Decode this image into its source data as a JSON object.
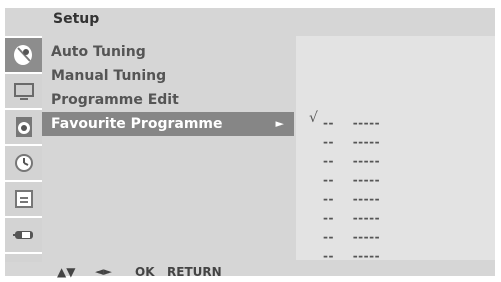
{
  "header": {
    "title": "Setup"
  },
  "sidebar": {
    "items": [
      {
        "icon": "satellite-dish-icon"
      },
      {
        "icon": "tv-picture-icon"
      },
      {
        "icon": "speaker-audio-icon"
      },
      {
        "icon": "clock-time-icon"
      },
      {
        "icon": "lock-option-icon"
      },
      {
        "icon": "input-source-icon"
      }
    ]
  },
  "menu": {
    "items": [
      {
        "label": "Auto Tuning"
      },
      {
        "label": "Manual Tuning"
      },
      {
        "label": "Programme Edit"
      },
      {
        "label": "Favourite Programme",
        "arrow": "►"
      }
    ]
  },
  "favourites": {
    "checkmark": "√",
    "rows": [
      {
        "number": "--",
        "name": "-----"
      },
      {
        "number": "--",
        "name": "-----"
      },
      {
        "number": "--",
        "name": "-----"
      },
      {
        "number": "--",
        "name": "-----"
      },
      {
        "number": "--",
        "name": "-----"
      },
      {
        "number": "--",
        "name": "-----"
      },
      {
        "number": "--",
        "name": "-----"
      },
      {
        "number": "--",
        "name": "-----"
      }
    ]
  },
  "footer": {
    "updown": "▲▼",
    "leftright": "◄►",
    "ok": "OK",
    "return": "RETURN"
  }
}
